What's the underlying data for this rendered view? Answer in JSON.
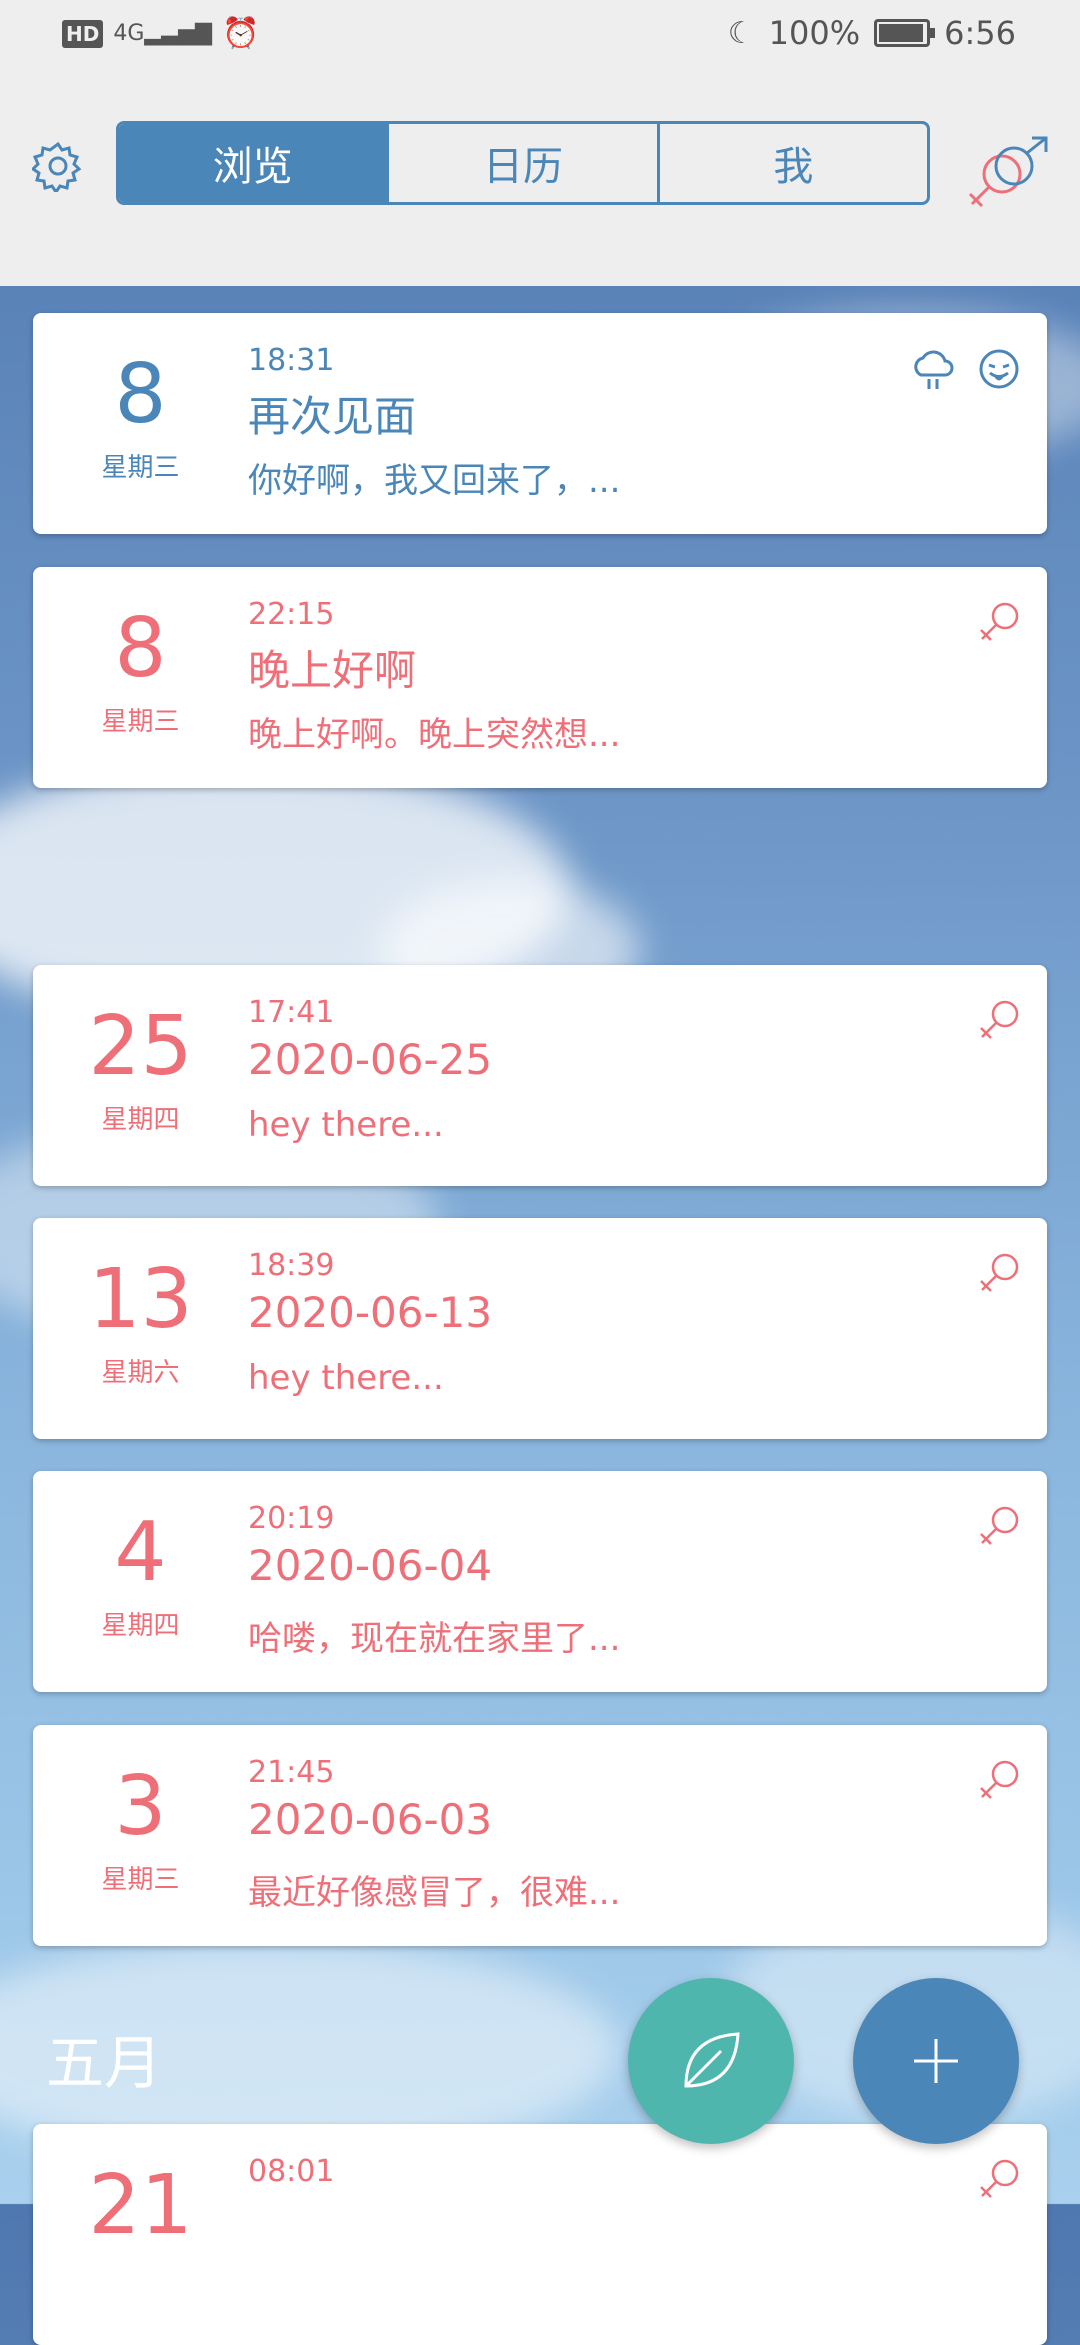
{
  "status_bar": {
    "left_icons": "HD 4G",
    "battery": "100%",
    "battery_level": 1.0,
    "time": "6:56"
  },
  "tabs": [
    {
      "label": "浏览",
      "active": true
    },
    {
      "label": "日历",
      "active": false
    },
    {
      "label": "我",
      "active": false
    }
  ],
  "entries": [
    {
      "day": "8",
      "weekday": "星期三",
      "time": "18:31",
      "title": "再次见面",
      "snippet": "你好啊，我又回来了，...",
      "color": "#4a86b8",
      "icons": [
        "cloud-rain-icon",
        "tongue-face-icon"
      ]
    },
    {
      "day": "8",
      "weekday": "星期三",
      "time": "22:15",
      "title": "晚上好啊",
      "snippet": "晚上好啊。晚上突然想...",
      "color": "#ef6f78",
      "icons": [
        "female-symbol-icon"
      ]
    },
    {
      "day": "25",
      "weekday": "星期四",
      "time": "17:41",
      "title": "2020-06-25",
      "snippet": "hey there...",
      "color": "#ef6f78",
      "icons": [
        "female-symbol-icon"
      ]
    },
    {
      "day": "13",
      "weekday": "星期六",
      "time": "18:39",
      "title": "2020-06-13",
      "snippet": "hey there...",
      "color": "#ef6f78",
      "icons": [
        "female-symbol-icon"
      ]
    },
    {
      "day": "4",
      "weekday": "星期四",
      "time": "20:19",
      "title": "2020-06-04",
      "snippet": "哈喽，现在就在家里了...",
      "color": "#ef6f78",
      "icons": [
        "female-symbol-icon"
      ]
    },
    {
      "day": "3",
      "weekday": "星期三",
      "time": "21:45",
      "title": "2020-06-03",
      "snippet": "最近好像感冒了，很难...",
      "color": "#ef6f78",
      "icons": [
        "female-symbol-icon"
      ]
    },
    {
      "day": "21",
      "weekday": "",
      "time": "08:01",
      "title": "",
      "snippet": "",
      "color": "#ef6f78",
      "icons": [
        "female-symbol-icon"
      ]
    }
  ],
  "month_header": "五月",
  "colors": {
    "accent": "#4a86b8",
    "pink": "#ef6f78",
    "teal": "#4fb6ad"
  }
}
